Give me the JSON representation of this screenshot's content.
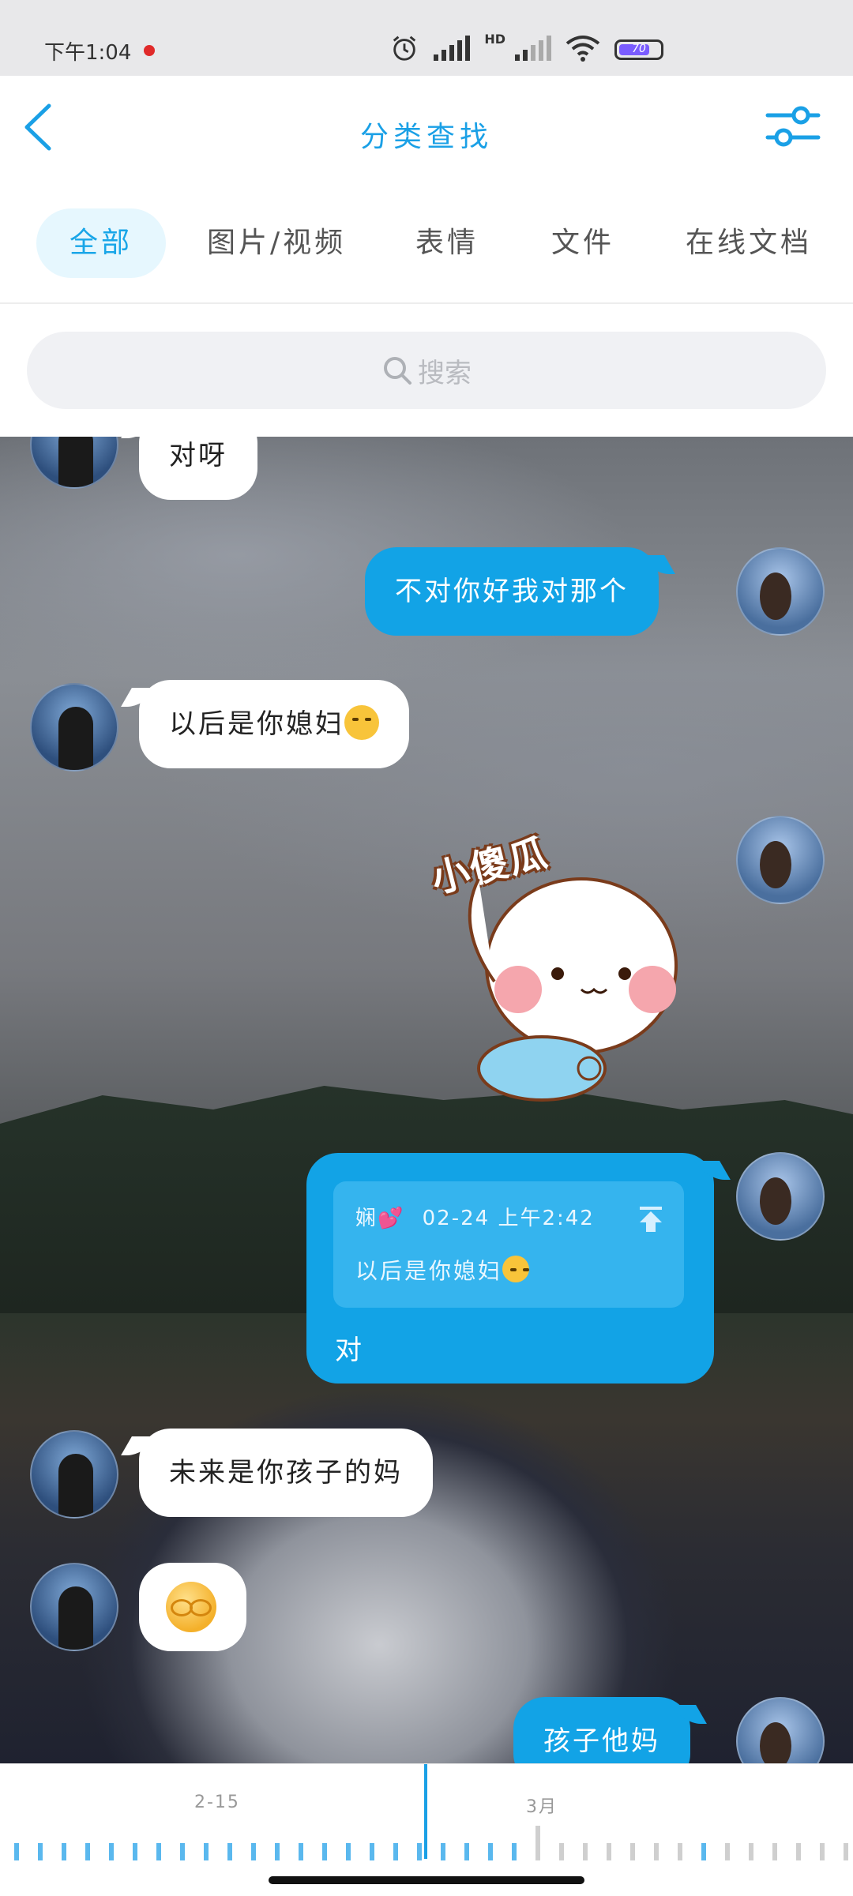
{
  "status_bar": {
    "time": "下午1:04",
    "network": "HD",
    "battery": "70"
  },
  "header": {
    "title": "分类查找"
  },
  "tabs": [
    {
      "label": "全部",
      "active": true
    },
    {
      "label": "图片/视频",
      "active": false
    },
    {
      "label": "表情",
      "active": false
    },
    {
      "label": "文件",
      "active": false
    },
    {
      "label": "在线文档",
      "active": false
    }
  ],
  "search": {
    "placeholder": "搜索"
  },
  "messages": [
    {
      "side": "left",
      "text": "对呀"
    },
    {
      "side": "right",
      "text": "不对你好我对那个"
    },
    {
      "side": "left",
      "text": "以后是你媳妇"
    },
    {
      "side": "right",
      "type": "sticker",
      "text": "小傻瓜"
    },
    {
      "side": "right",
      "type": "quote",
      "quote_sender": "娴💕",
      "quote_time": "02-24 上午2:42",
      "quote_text": "以后是你媳妇",
      "text": "对"
    },
    {
      "side": "left",
      "text": "未来是你孩子的妈"
    },
    {
      "side": "left",
      "type": "emoji"
    },
    {
      "side": "right",
      "text": "孩子他妈"
    }
  ],
  "timeline": {
    "labels": [
      "2-15",
      "3月"
    ]
  },
  "colors": {
    "accent": "#1aa0e6",
    "bubble_blue": "#12a3e6",
    "bubble_white": "#ffffff"
  }
}
